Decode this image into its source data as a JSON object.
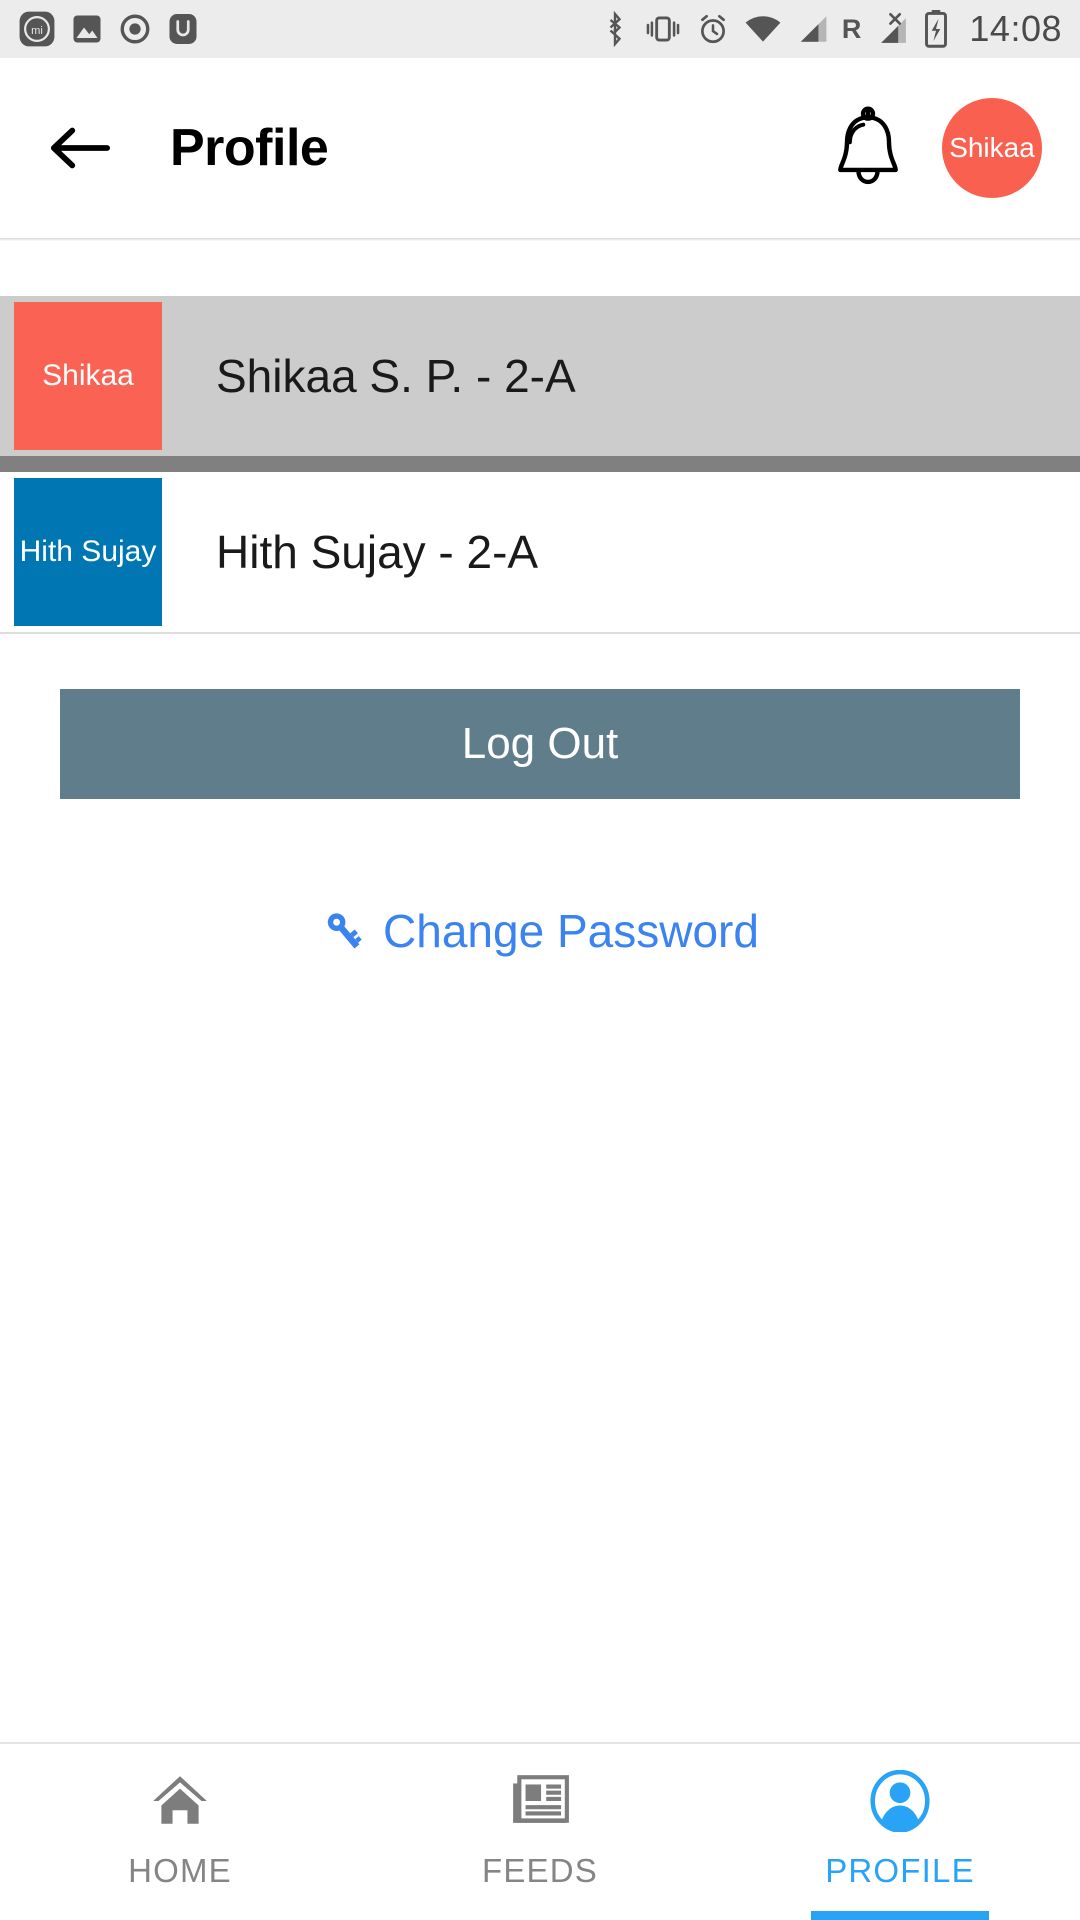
{
  "statusbar": {
    "time": "14:08",
    "roaming_label": "R",
    "left_icons": [
      "mi-security-app-icon",
      "gallery-app-icon",
      "record-dot-icon",
      "app-icon"
    ],
    "right_icons": [
      "bluetooth-icon",
      "vibrate-icon",
      "alarm-icon",
      "wifi-icon",
      "signal-bars-icon",
      "roaming-icon",
      "no-sim-signal-icon",
      "battery-charging-icon"
    ],
    "background": "#ececec"
  },
  "appbar": {
    "back_label": "back-arrow",
    "title": "Profile",
    "bell_label": "notifications",
    "avatar_text": "Shikaa",
    "avatar_color": "#f9604f"
  },
  "users": [
    {
      "avatar_text": "Shikaa",
      "avatar_color": "#fa6254",
      "label": "Shikaa S. P. - 2-A",
      "selected": true
    },
    {
      "avatar_text": "Hith Sujay",
      "avatar_color": "#0077b3",
      "label": "Hith Sujay - 2-A",
      "selected": false
    }
  ],
  "actions": {
    "logout_label": "Log Out",
    "logout_color": "#607d8b",
    "change_password_label": "Change Password",
    "change_password_color": "#3b83f0",
    "key_icon": "key-icon"
  },
  "bottomnav": {
    "items": [
      {
        "label": "HOME",
        "icon": "home-icon",
        "active": false
      },
      {
        "label": "FEEDS",
        "icon": "newspaper-icon",
        "active": false
      },
      {
        "label": "PROFILE",
        "icon": "person-icon",
        "active": true
      }
    ],
    "active_color": "#29a3f5",
    "inactive_color": "#858585"
  }
}
